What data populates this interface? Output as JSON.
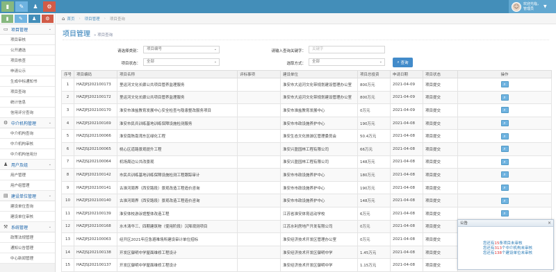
{
  "header": {
    "user_greeting": "欢迎光临，",
    "user_name": "管理员"
  },
  "shortcut_colors": [
    "#87b87f",
    "#6fb3e0",
    "#438eb9",
    "#d15b47"
  ],
  "breadcrumb": {
    "home": "首页",
    "level1": "项目管理",
    "level2": "项目查询"
  },
  "sidebar": {
    "sections": [
      {
        "label": "项目管理",
        "icon": "desktop-icon",
        "items": [
          "项目审核",
          "公开遴选",
          "项目核查",
          "申请公示",
          "生成中标通知书",
          "项目查询",
          "统计信息",
          "信用评分查询"
        ]
      },
      {
        "label": "中介机构管理",
        "icon": "gears-icon",
        "items": [
          "中介机构查询",
          "中介机构审核",
          "中介机构信用分"
        ]
      },
      {
        "label": "用户及组",
        "icon": "users-icon",
        "items": [
          "用户管理",
          "用户组管理"
        ]
      },
      {
        "label": "建设单位管理",
        "icon": "building-icon",
        "items": [
          "建设单位查询",
          "建设单位审核"
        ]
      },
      {
        "label": "系统管理",
        "icon": "tools-icon",
        "items": [
          "政策法规管理",
          "通知公告管理",
          "中心新闻管理"
        ]
      }
    ]
  },
  "page": {
    "title": "项目管理",
    "subtitle": "» 项目查询"
  },
  "filters": {
    "category_label": "请选择类别：",
    "category_value": "项目编号",
    "keyword_label": "请输入查询关键字：",
    "keyword_placeholder": "关键字",
    "status_label": "项目状态：",
    "status_value": "全部",
    "method_label": "选取方式：",
    "method_value": "全部",
    "query_button": "查询"
  },
  "table": {
    "headers": [
      "序号",
      "项目编码",
      "项目名称",
      "评标事项",
      "建设单位",
      "项目总投资",
      "申请日期",
      "项目状态",
      "操作"
    ],
    "rows": [
      [
        "1",
        "HAZJPJ202100173",
        "里运河文化长廊公共项目管养监理服务",
        "",
        "淮安市大运河文化带规划建设管理办公室",
        "800万元",
        "2021-04-09",
        "项目提交"
      ],
      [
        "2",
        "HAZJPJ202100172",
        "里运河文化长廊公共项目管养监理服务",
        "",
        "淮安市大运河文化带规划建设管理办公室",
        "800万元",
        "2021-04-09",
        "项目提交"
      ],
      [
        "3",
        "HAZJPJ202100170",
        "淮安市淮盐教育发展中心安全检查与隐患整改服务项目",
        "",
        "淮安市淮盐教育发展中心",
        "0万元",
        "2021-04-09",
        "项目提交"
      ],
      [
        "4",
        "HAZJPJ202100169",
        "淮安市民兵训练基地训练保障设施检测服务",
        "",
        "淮安市市政设施养护中心",
        "190万元",
        "2021-04-08",
        "项目提交"
      ],
      [
        "5",
        "HAZJSJ202100066",
        "淮安南陈南湾东区绿化工程",
        "",
        "淮安生态文化旅游区管理委员会",
        "50.4万元",
        "2021-04-08",
        "项目提交"
      ],
      [
        "6",
        "HAZJSJ202100065",
        "桃心区道路景观提升工程",
        "",
        "淮安兴盈园林工程有限公司",
        "66万元",
        "2021-04-08",
        "项目提交"
      ],
      [
        "7",
        "HAZJSJ202100064",
        "机场周边公共改景观",
        "",
        "淮安兴盈园林工程有限公司",
        "148万元",
        "2021-04-08",
        "项目提交"
      ],
      [
        "8",
        "HAZJPJ202100142",
        "市民兵训练基地训练保障设施检测工程跟踪审计",
        "",
        "淮安市市政设施养护中心",
        "180万元",
        "2021-04-08",
        "项目提交"
      ],
      [
        "9",
        "HAZJPJ202100141",
        "古淮河周界（西安路段）景观改造工程造价咨询",
        "",
        "淮安市市政设施养护中心",
        "190万元",
        "2021-04-08",
        "项目提交"
      ],
      [
        "10",
        "HAZJPJ202100140",
        "古淮河周界（西安路段）景观改造工程造价咨询",
        "",
        "淮安市市政设施养护中心",
        "148万元",
        "2021-04-08",
        "项目提交"
      ],
      [
        "11",
        "HAZJPJ202100139",
        "淮安体校游泳馆整体改造工程",
        "",
        "江苏省淮安体育运动学校",
        "6万元",
        "2021-04-08",
        "项目提交"
      ],
      [
        "12",
        "HAZJPJ202100168",
        "水木清华三、四期建筑物（使用阶段）沉降观测项目",
        "",
        "江苏水利房地产开发有限公司",
        "0万元",
        "2021-04-08",
        "项目提交"
      ],
      [
        "13",
        "HAZJPJ202100063",
        "经开区2021年应急避难场所建设审计单位招标",
        "",
        "淮安经济技术开发区管理办公室",
        "0万元",
        "2021-04-08",
        "项目提交"
      ],
      [
        "14",
        "HAZJSJ202100138",
        "开发区御明中学屋面维修工程设计",
        "",
        "淮安经济技术开发区御明中学",
        "1.45万元",
        "2021-04-08",
        "项目提交"
      ],
      [
        "15",
        "HAZJSJ202100137",
        "开发区御明中学屋面维修工程设计",
        "",
        "淮安经济技术开发区御明中学",
        "1.15万元",
        "2021-04-08",
        "项目提交"
      ]
    ]
  },
  "notice": {
    "title": "公告",
    "prefix": "您还有",
    "count1": "15",
    "suffix1": "条项目未审核",
    "count2": "313",
    "suffix2": "个中介机构未审核",
    "count3": "138",
    "suffix3": "个建设单位未审核"
  }
}
